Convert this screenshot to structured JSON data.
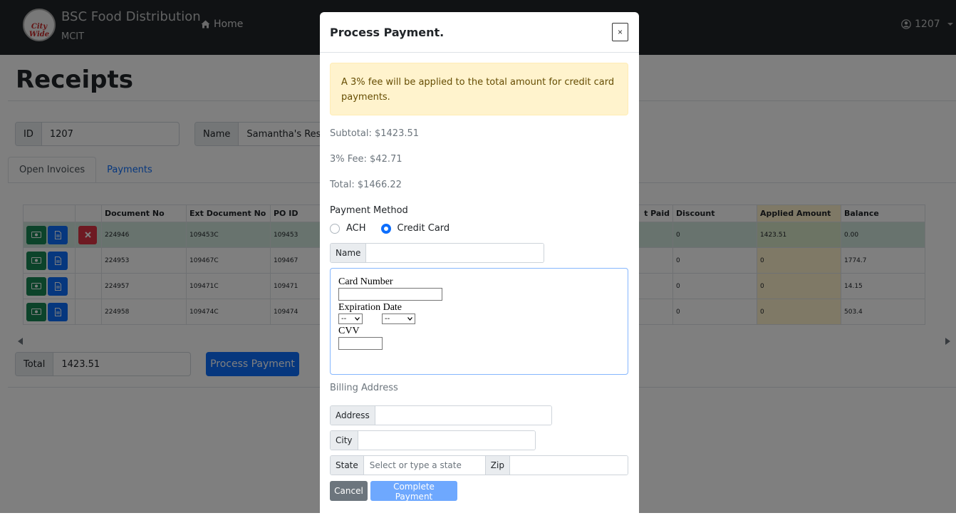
{
  "navbar": {
    "logo_text": "City Wide",
    "brand_title": "BSC Food Distribution",
    "brand_subtitle": "MCIT",
    "home_label": "Home",
    "user_label": "1207"
  },
  "page": {
    "title": "Receipts",
    "id_label": "ID",
    "id_value": "1207",
    "name_label": "Name",
    "name_value": "Samantha's Rest",
    "tabs": [
      {
        "label": "Open Invoices",
        "active": true
      },
      {
        "label": "Payments",
        "active": false
      }
    ],
    "table": {
      "columns": [
        "Document No",
        "Ext Document No",
        "PO ID",
        "t Paid",
        "Discount",
        "Applied Amount",
        "Balance"
      ],
      "rows": [
        {
          "document_no": "224946",
          "ext_document_no": "109453C",
          "po_id": "109453",
          "discount": "0",
          "applied_amount": "1423.51",
          "balance": "0.00",
          "selected": true
        },
        {
          "document_no": "224953",
          "ext_document_no": "109467C",
          "po_id": "109467",
          "discount": "0",
          "applied_amount": "0",
          "balance": "1774.7",
          "selected": false
        },
        {
          "document_no": "224957",
          "ext_document_no": "109471C",
          "po_id": "109471",
          "discount": "0",
          "applied_amount": "0",
          "balance": "14.15",
          "selected": false
        },
        {
          "document_no": "224958",
          "ext_document_no": "109474C",
          "po_id": "109474",
          "discount": "0",
          "applied_amount": "0",
          "balance": "503.4",
          "selected": false
        }
      ]
    },
    "total_label": "Total",
    "total_value": "1423.51",
    "process_payment_label": "Process Payment"
  },
  "modal": {
    "title": "Process Payment.",
    "close_label": "×",
    "alert_text": "A 3% fee will be applied to the total amount for credit card payments.",
    "subtotal": "Subtotal: $1423.51",
    "fee": "3% Fee: $42.71",
    "total": "Total: $1466.22",
    "payment_method_label": "Payment Method",
    "payment_options": [
      {
        "label": "ACH",
        "checked": false
      },
      {
        "label": "Credit Card",
        "checked": true
      }
    ],
    "name_label": "Name",
    "name_value": "",
    "card_number_label": "Card Number",
    "expiration_label": "Expiration Date",
    "exp_month": "--",
    "exp_year": "--",
    "cvv_label": "CVV",
    "billing_address_label": "Billing Address",
    "address_label": "Address",
    "city_label": "City",
    "state_label": "State",
    "state_placeholder": "Select or type a state",
    "zip_label": "Zip",
    "cancel_label": "Cancel",
    "complete_label": "Complete Payment"
  },
  "colors": {
    "primary": "#0d6efd",
    "success": "#198754",
    "danger": "#dc3545",
    "navbar": "#212529",
    "alert_bg": "#fff3cd"
  }
}
